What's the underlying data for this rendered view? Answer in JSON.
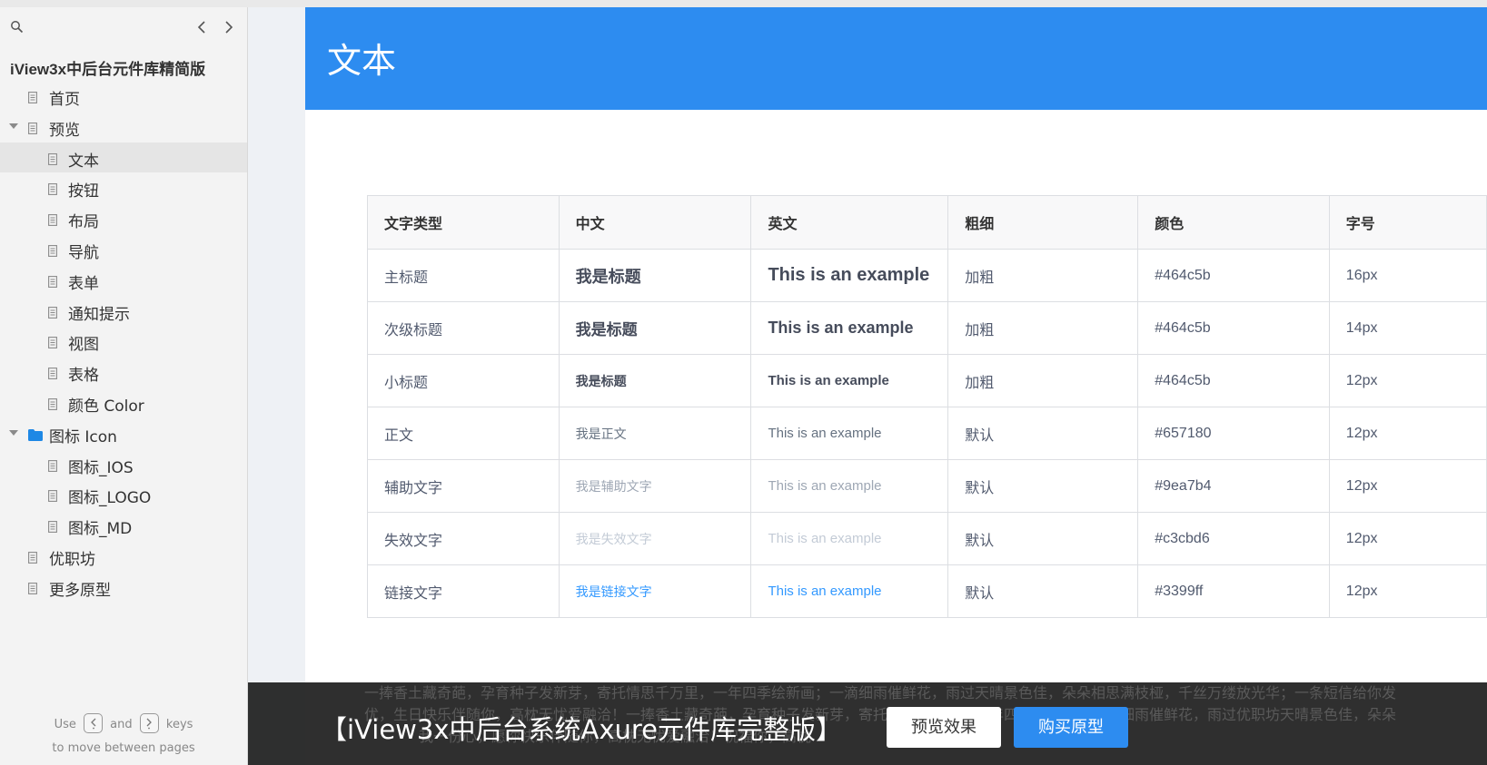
{
  "sidebar": {
    "title": "iView3x中后台元件库精简版",
    "hint_use": "Use",
    "hint_and": "and",
    "hint_keys": "keys",
    "hint_line2": "to move between pages",
    "items": [
      {
        "label": "首页",
        "level": 1,
        "icon": "page-icon"
      },
      {
        "label": "预览",
        "level": 1,
        "icon": "page-icon",
        "expanded": true
      },
      {
        "label": "文本",
        "level": 2,
        "icon": "page-icon",
        "selected": true
      },
      {
        "label": "按钮",
        "level": 2,
        "icon": "page-icon"
      },
      {
        "label": "布局",
        "level": 2,
        "icon": "page-icon"
      },
      {
        "label": "导航",
        "level": 2,
        "icon": "page-icon"
      },
      {
        "label": "表单",
        "level": 2,
        "icon": "page-icon"
      },
      {
        "label": "通知提示",
        "level": 2,
        "icon": "page-icon"
      },
      {
        "label": "视图",
        "level": 2,
        "icon": "page-icon"
      },
      {
        "label": "表格",
        "level": 2,
        "icon": "page-icon"
      },
      {
        "label": "颜色 Color",
        "level": 2,
        "icon": "page-icon"
      },
      {
        "label": "图标 Icon",
        "level": 1,
        "icon": "folder-icon",
        "expanded": true
      },
      {
        "label": "图标_IOS",
        "level": 2,
        "icon": "page-icon"
      },
      {
        "label": "图标_LOGO",
        "level": 2,
        "icon": "page-icon"
      },
      {
        "label": "图标_MD",
        "level": 2,
        "icon": "page-icon"
      },
      {
        "label": "优职坊",
        "level": 1,
        "icon": "page-icon"
      },
      {
        "label": "更多原型",
        "level": 1,
        "icon": "page-icon"
      }
    ]
  },
  "page": {
    "title": "文本"
  },
  "table": {
    "headers": [
      "文字类型",
      "中文",
      "英文",
      "粗细",
      "颜色",
      "字号"
    ],
    "rows": [
      {
        "type": "主标题",
        "zh": "我是标题",
        "en": "This is an example",
        "weight": "加粗",
        "color": "#464c5b",
        "size": "16px"
      },
      {
        "type": "次级标题",
        "zh": "我是标题",
        "en": "This is an example",
        "weight": "加粗",
        "color": "#464c5b",
        "size": "14px"
      },
      {
        "type": "小标题",
        "zh": "我是标题",
        "en": "This is an example",
        "weight": "加粗",
        "color": "#464c5b",
        "size": "12px"
      },
      {
        "type": "正文",
        "zh": "我是正文",
        "en": "This is an example",
        "weight": "默认",
        "color": "#657180",
        "size": "12px"
      },
      {
        "type": "辅助文字",
        "zh": "我是辅助文字",
        "en": "This is an example",
        "weight": "默认",
        "color": "#9ea7b4",
        "size": "12px"
      },
      {
        "type": "失效文字",
        "zh": "我是失效文字",
        "en": "This is an example",
        "weight": "默认",
        "color": "#c3cbd6",
        "size": "12px"
      },
      {
        "type": "链接文字",
        "zh": "我是链接文字",
        "en": "This is an example",
        "weight": "默认",
        "color": "#3399ff",
        "size": "12px"
      }
    ]
  },
  "promo": {
    "marquee_line1": "一捧香土藏奇葩，孕育种子发新芽，寄托情思千万里，一年四季绘新画；一滴细雨催鲜花，雨过天晴景色佳，朵朵相思满枝桠，千丝万缕放光华；一条短信给你发",
    "marquee_line2": "优，生日快乐伴随你，高枕无忧爱融洽！一捧香土藏奇葩，孕育种子发新芽，寄托情思千万里，一年四季绘新画；一滴细雨催鲜花，雨过优职坊天晴景色佳，朵朵",
    "marquee_line3": "我一份心，愿你快乐伴随你，高枕无忧爱融洽！祝福你，高枕",
    "title": "【iView3x中后台系统Axure元件库完整版】",
    "preview_label": "预览效果",
    "buy_label": "购买原型"
  }
}
